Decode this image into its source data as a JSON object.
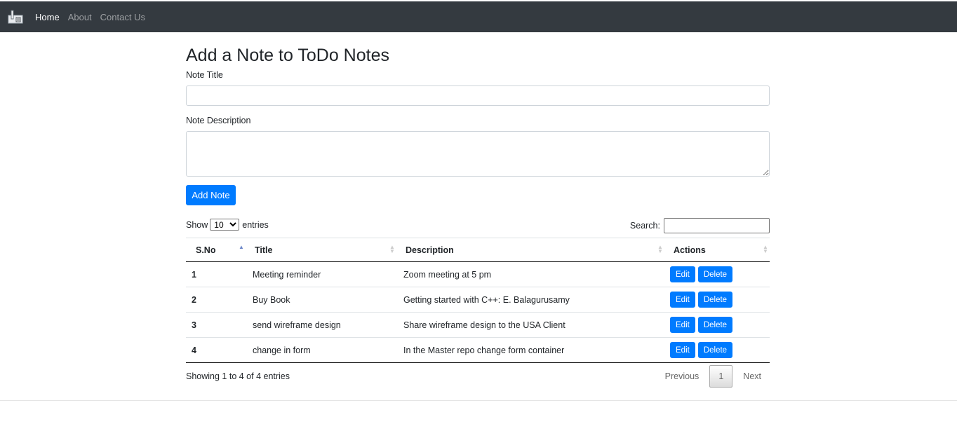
{
  "navbar": {
    "brand_icon": "notes-logo-icon",
    "links": [
      {
        "label": "Home",
        "active": true
      },
      {
        "label": "About",
        "active": false
      },
      {
        "label": "Contact Us",
        "active": false
      }
    ]
  },
  "form": {
    "heading": "Add a Note to ToDo Notes",
    "title_label": "Note Title",
    "title_value": "",
    "description_label": "Note Description",
    "description_value": "",
    "submit_label": "Add Note"
  },
  "table_controls": {
    "show_label": "Show",
    "entries_label": "entries",
    "page_length_selected": "10",
    "search_label": "Search:",
    "search_value": ""
  },
  "table": {
    "columns": [
      "S.No",
      "Title",
      "Description",
      "Actions"
    ],
    "sorted_column": "S.No",
    "sort_direction": "ascending",
    "rows": [
      {
        "sno": "1",
        "title": "Meeting reminder",
        "description": "Zoom meeting at 5 pm",
        "edit": "Edit",
        "delete": "Delete"
      },
      {
        "sno": "2",
        "title": "Buy Book",
        "description": "Getting started with C++: E. Balagurusamy",
        "edit": "Edit",
        "delete": "Delete"
      },
      {
        "sno": "3",
        "title": "send wireframe design",
        "description": "Share wireframe design to the USA Client",
        "edit": "Edit",
        "delete": "Delete"
      },
      {
        "sno": "4",
        "title": "change in form",
        "description": "In the Master repo change form container",
        "edit": "Edit",
        "delete": "Delete"
      }
    ]
  },
  "footer": {
    "info": "Showing 1 to 4 of 4 entries",
    "previous_label": "Previous",
    "current_page": "1",
    "next_label": "Next"
  },
  "colors": {
    "navbar_bg": "#343a40",
    "primary": "#007bff"
  }
}
